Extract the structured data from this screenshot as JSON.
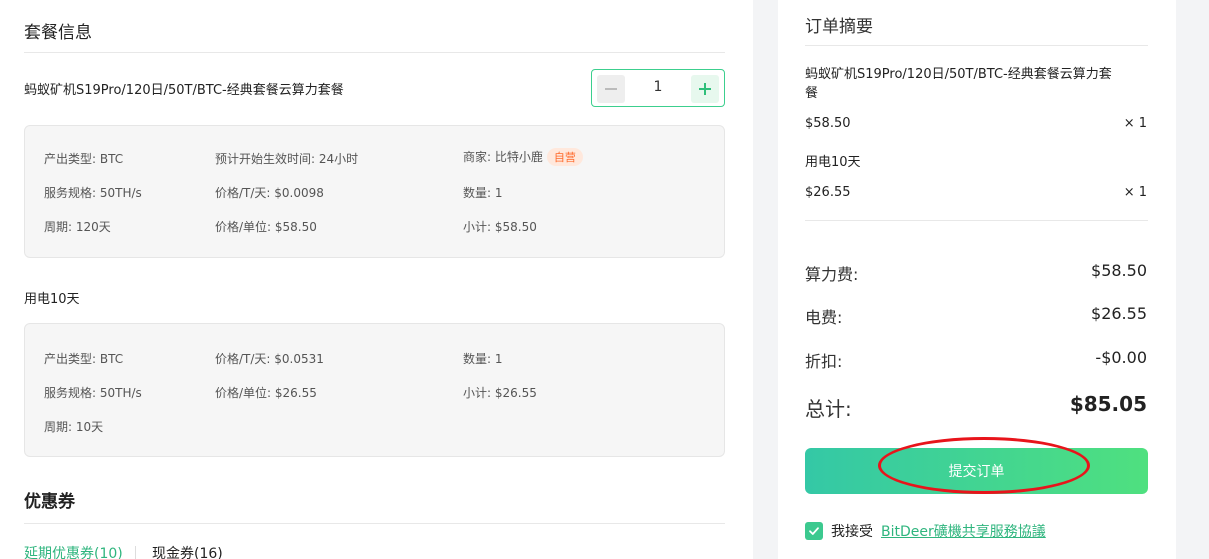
{
  "package": {
    "section_title": "套餐信息",
    "product_name": "蚂蚁矿机S19Pro/120日/50T/BTC-经典套餐云算力套餐",
    "quantity": "1",
    "details": {
      "output_type": "产出类型: BTC",
      "spec": "服务规格: 50TH/s",
      "period": "周期: 120天",
      "effective_time": "预计开始生效时间: 24小时",
      "price_per_t": "价格/T/天: $0.0098",
      "unit_price": "价格/单位: $58.50",
      "merchant": "商家: 比特小鹿",
      "merchant_badge": "自营",
      "count": "数量: 1",
      "subtotal": "小计: $58.50"
    }
  },
  "electricity": {
    "title": "用电10天",
    "details": {
      "output_type": "产出类型: BTC",
      "spec": "服务规格: 50TH/s",
      "period": "周期: 10天",
      "price_per_t": "价格/T/天: $0.0531",
      "unit_price": "价格/单位: $26.55",
      "count": "数量: 1",
      "subtotal": "小计: $26.55"
    }
  },
  "coupons": {
    "title": "优惠券",
    "tabs": [
      {
        "label": "延期优惠券(10)",
        "active": true
      },
      {
        "label": "现金券(16)",
        "active": false
      }
    ]
  },
  "summary": {
    "title": "订单摘要",
    "item1_name": "蚂蚁矿机S19Pro/120日/50T/BTC-经典套餐云算力套",
    "item1_name_wrap": "餐",
    "item1_price": "$58.50",
    "item1_mult": "× 1",
    "item2_name": "用电10天",
    "item2_price": "$26.55",
    "item2_mult": "× 1",
    "hash_fee_label": "算力费:",
    "hash_fee": "$58.50",
    "power_fee_label": "电费:",
    "power_fee": "$26.55",
    "discount_label": "折扣:",
    "discount": "-$0.00",
    "total_label": "总计:",
    "total": "$85.05",
    "submit_label": "提交订单",
    "agree_text": "我接受",
    "agree_link": "BitDeer礦機共享服務協議"
  },
  "colors": {
    "accent": "#3ccf8e",
    "annotation": "#e8141b",
    "badge": "#ff6a2b"
  }
}
